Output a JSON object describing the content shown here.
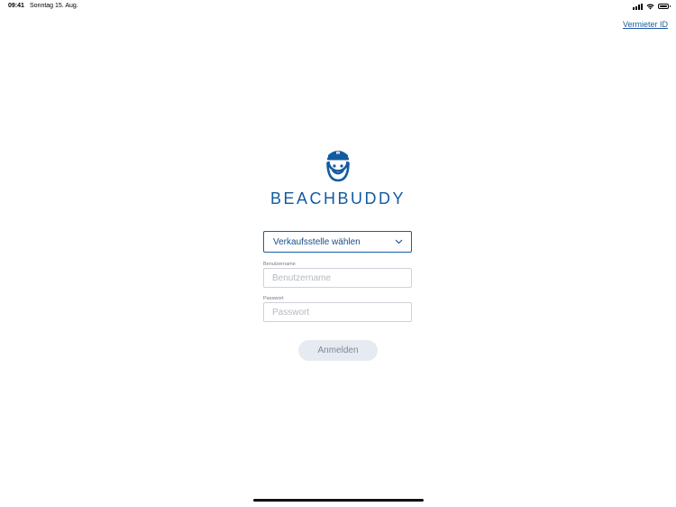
{
  "status_bar": {
    "time": "09:41",
    "date": "Sonntag 15. Aug."
  },
  "header": {
    "vermieter_link": "Vermieter ID"
  },
  "brand": {
    "name": "BEACHBUDDY",
    "color": "#135ba0",
    "logo_icon": "captain-smiley-icon"
  },
  "form": {
    "salespoint_select": {
      "selected": "Verkaufsstelle wählen",
      "icon": "chevron-down-icon"
    },
    "username": {
      "label": "Benutzername",
      "placeholder": "Benutzername",
      "value": ""
    },
    "password": {
      "label": "Passwort",
      "placeholder": "Passwort",
      "value": ""
    },
    "login_label": "Anmelden"
  },
  "colors": {
    "accent": "#1a5da6",
    "button_bg": "#e6ebf2",
    "button_text": "#7e8794"
  }
}
